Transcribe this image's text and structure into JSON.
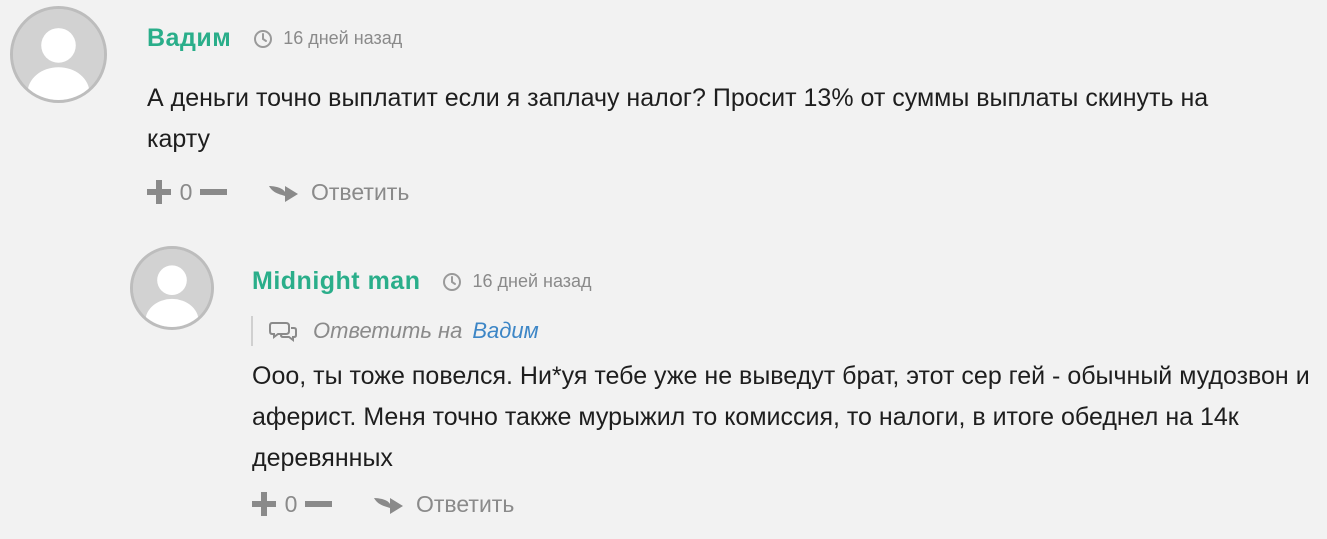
{
  "comments": [
    {
      "author": "Вадим",
      "time": "16 дней назад",
      "text_lines": [
        "А деньги точно выплатит если я заплачу налог? Просит 13% от суммы выплаты скинуть на",
        "карту"
      ],
      "votes": "0",
      "reply_label": "Ответить"
    },
    {
      "author": "Midnight man",
      "time": "16 дней назад",
      "reply_to_label": "Ответить на",
      "reply_to_user": "Вадим",
      "text_lines": [
        "Ооо, ты тоже повелся. Ни*уя тебе уже не выведут брат, этот сер гей - обычный мудозвон и",
        "аферист. Меня точно также мурыжил то комиссия, то налоги, в итоге обеднел на 14к",
        "деревянных"
      ],
      "votes": "0",
      "reply_label": "Ответить"
    }
  ],
  "colors": {
    "author": "#2aae8a",
    "link": "#3d86c6",
    "muted": "#8a8a8a",
    "background": "#f2f2f2"
  },
  "icons": [
    "avatar-placeholder",
    "clock-icon",
    "plus-icon",
    "minus-icon",
    "reply-arrow-icon",
    "chat-bubbles-icon"
  ]
}
